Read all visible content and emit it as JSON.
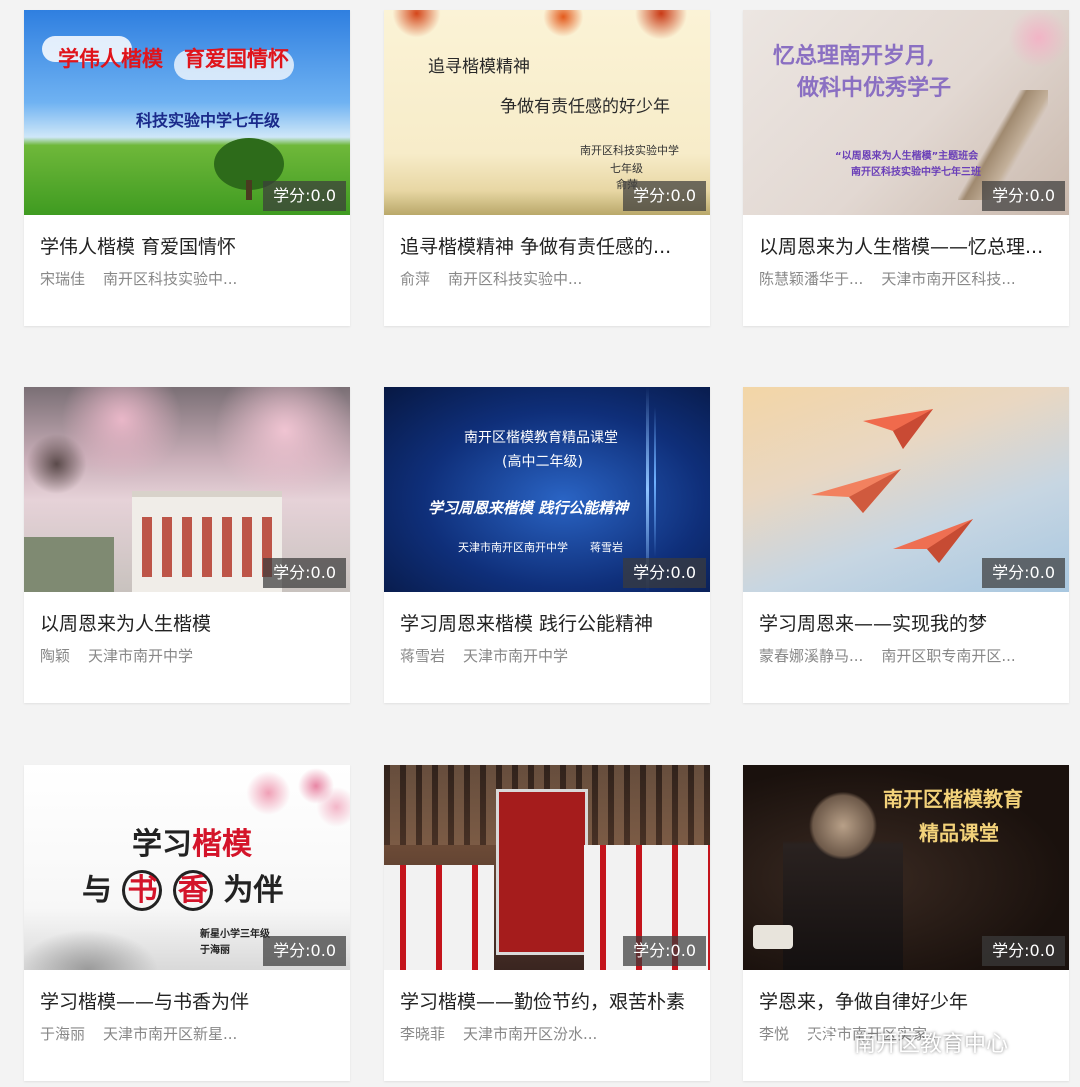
{
  "cards": [
    {
      "title": "学伟人楷模 育爱国情怀",
      "teacher": "宋瑞佳",
      "school": "南开区科技实验中...",
      "credit": "学分:0.0",
      "thumb": {
        "line1": "学伟人楷模　育爱国情怀",
        "line2": "科技实验中学七年级"
      }
    },
    {
      "title": "追寻楷模精神 争做有责任感的...",
      "teacher": "俞萍",
      "school": "南开区科技实验中...",
      "credit": "学分:0.0",
      "thumb": {
        "line1": "追寻楷模精神",
        "line2": "争做有责任感的好少年",
        "line3": "南开区科技实验中学",
        "line4": "七年级",
        "line5": "俞萍"
      }
    },
    {
      "title": "以周恩来为人生楷模——忆总理...",
      "teacher": "陈慧颖潘华于...",
      "school": "天津市南开区科技...",
      "credit": "学分:0.0",
      "thumb": {
        "line1": "忆总理南开岁月,",
        "line2": "做科中优秀学子",
        "line3": "“以周恩来为人生楷模”主题班会",
        "line4": "南开区科技实验中学七年三班"
      }
    },
    {
      "title": "以周恩来为人生楷模",
      "teacher": "陶颖",
      "school": "天津市南开中学",
      "credit": "学分:0.0",
      "thumb": {}
    },
    {
      "title": "学习周恩来楷模 践行公能精神",
      "teacher": "蒋雪岩",
      "school": "天津市南开中学",
      "credit": "学分:0.0",
      "thumb": {
        "line1": "南开区楷模教育精品课堂",
        "line2": "(高中二年级)",
        "line3": "学习周恩来楷模 践行公能精神",
        "line4": "天津市南开区南开中学　　蒋雪岩"
      }
    },
    {
      "title": "学习周恩来——实现我的梦",
      "teacher": "蒙春娜溪静马...",
      "school": "南开区职专南开区...",
      "credit": "学分:0.0",
      "thumb": {}
    },
    {
      "title": "学习楷模——与书香为伴",
      "teacher": "于海丽",
      "school": "天津市南开区新星...",
      "credit": "学分:0.0",
      "thumb": {
        "line1": "学习",
        "line1b": "楷模",
        "line2a": "与",
        "line2b": "书",
        "line2c": "香",
        "line2d": "为伴",
        "line3": "新星小学三年级",
        "line4": "于海丽"
      }
    },
    {
      "title": "学习楷模——勤俭节约，艰苦朴素",
      "teacher": "李晓菲",
      "school": "天津市南开区汾水...",
      "credit": "学分:0.0",
      "thumb": {}
    },
    {
      "title": "学恩来，争做自律好少年",
      "teacher": "李悦",
      "school": "天津市南开区实家...",
      "credit": "学分:0.0",
      "thumb": {
        "line1": "南开区楷模教育",
        "line2": "精品课堂"
      }
    }
  ],
  "watermark": {
    "text": "南开区教育中心"
  },
  "colors": {
    "card_bg": "#ffffff",
    "page_bg": "#f3f3f3",
    "title": "#222222",
    "meta": "#888888"
  }
}
